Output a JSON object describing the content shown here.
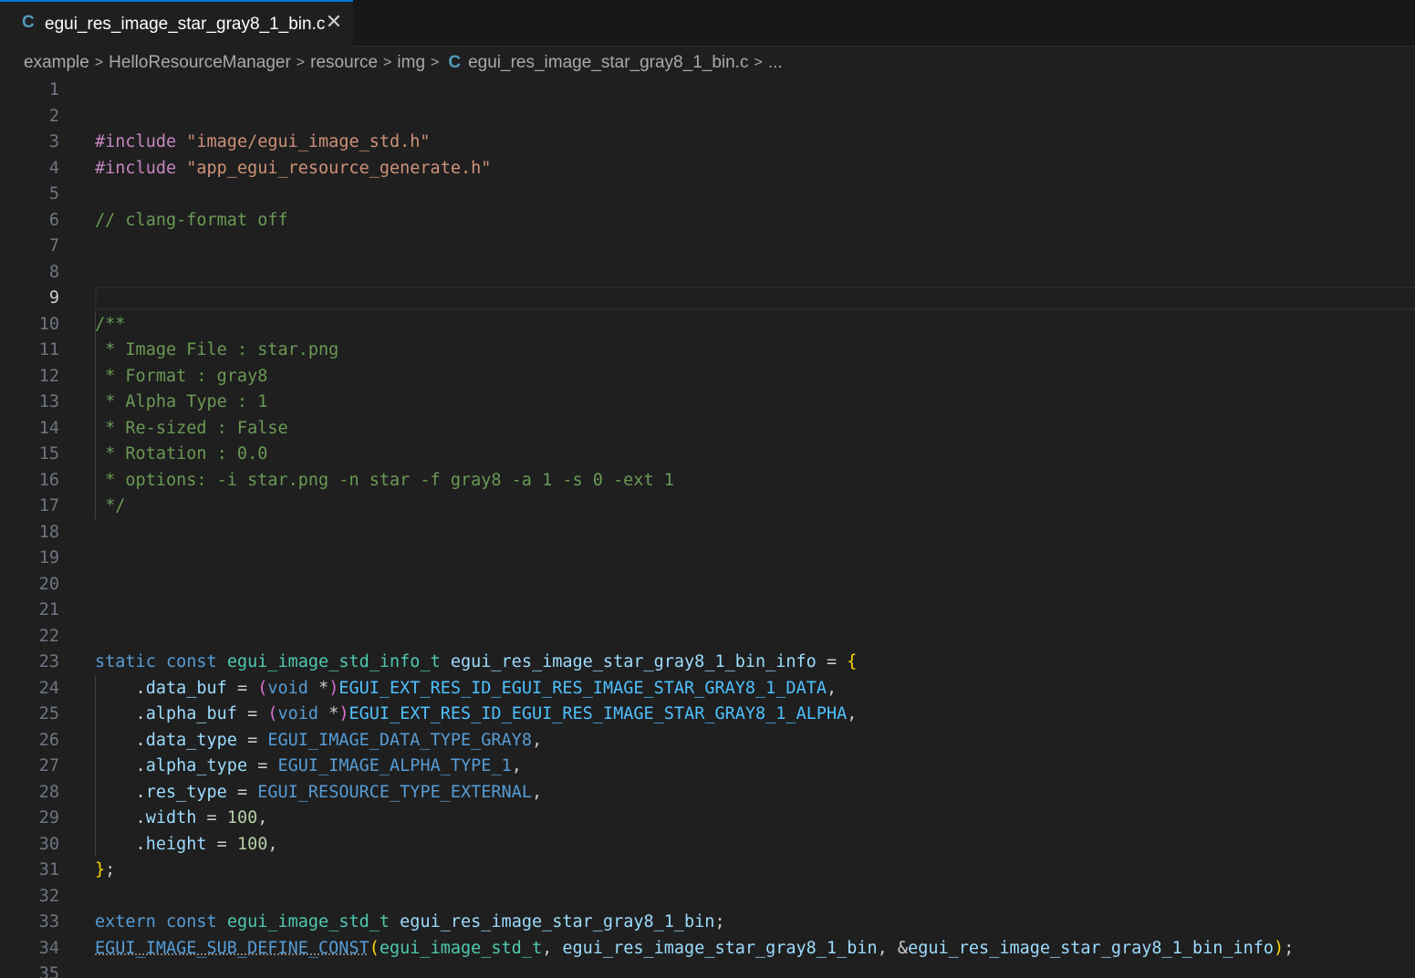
{
  "tab": {
    "icon": "C",
    "title": "egui_res_image_star_gray8_1_bin.c",
    "close": "✕"
  },
  "breadcrumb": {
    "items": [
      "example",
      "HelloResourceManager",
      "resource",
      "img"
    ],
    "file_icon": "C",
    "file": "egui_res_image_star_gray8_1_bin.c",
    "more": "...",
    "separator": ">"
  },
  "editor": {
    "active_line": 9,
    "lines": [
      {
        "n": "1",
        "t": []
      },
      {
        "n": "2",
        "t": []
      },
      {
        "n": "3",
        "t": [
          [
            "kw-inc",
            "#include"
          ],
          [
            "",
            " "
          ],
          [
            "str",
            "\"image/egui_image_std.h\""
          ]
        ]
      },
      {
        "n": "4",
        "t": [
          [
            "kw-inc",
            "#include"
          ],
          [
            "",
            " "
          ],
          [
            "str",
            "\"app_egui_resource_generate.h\""
          ]
        ]
      },
      {
        "n": "5",
        "t": []
      },
      {
        "n": "6",
        "t": [
          [
            "cmt",
            "// clang-format off"
          ]
        ]
      },
      {
        "n": "7",
        "t": []
      },
      {
        "n": "8",
        "t": []
      },
      {
        "n": "9",
        "t": []
      },
      {
        "n": "10",
        "t": [
          [
            "cmt",
            "/**"
          ]
        ]
      },
      {
        "n": "11",
        "t": [
          [
            "cmt",
            " * Image File : star.png"
          ]
        ]
      },
      {
        "n": "12",
        "t": [
          [
            "cmt",
            " * Format : gray8"
          ]
        ]
      },
      {
        "n": "13",
        "t": [
          [
            "cmt",
            " * Alpha Type : 1"
          ]
        ]
      },
      {
        "n": "14",
        "t": [
          [
            "cmt",
            " * Re-sized : False"
          ]
        ]
      },
      {
        "n": "15",
        "t": [
          [
            "cmt",
            " * Rotation : 0.0"
          ]
        ]
      },
      {
        "n": "16",
        "t": [
          [
            "cmt",
            " * options: -i star.png -n star -f gray8 -a 1 -s 0 -ext 1"
          ]
        ]
      },
      {
        "n": "17",
        "t": [
          [
            "cmt",
            " */"
          ]
        ]
      },
      {
        "n": "18",
        "t": []
      },
      {
        "n": "19",
        "t": []
      },
      {
        "n": "20",
        "t": []
      },
      {
        "n": "21",
        "t": []
      },
      {
        "n": "22",
        "t": []
      },
      {
        "n": "23",
        "t": [
          [
            "kw",
            "static"
          ],
          [
            "",
            " "
          ],
          [
            "kw",
            "const"
          ],
          [
            "",
            " "
          ],
          [
            "typ",
            "egui_image_std_info_t"
          ],
          [
            "",
            " "
          ],
          [
            "var",
            "egui_res_image_star_gray8_1_bin_info"
          ],
          [
            "",
            " = "
          ],
          [
            "brace1",
            "{"
          ]
        ]
      },
      {
        "n": "24",
        "t": [
          [
            "",
            "    ."
          ],
          [
            "var",
            "data_buf"
          ],
          [
            "",
            " = "
          ],
          [
            "brace2",
            "("
          ],
          [
            "kw",
            "void"
          ],
          [
            "",
            " *"
          ],
          [
            "brace2",
            ")"
          ],
          [
            "mac",
            "EGUI_EXT_RES_ID_EGUI_RES_IMAGE_STAR_GRAY8_1_DATA"
          ],
          [
            "",
            ","
          ]
        ]
      },
      {
        "n": "25",
        "t": [
          [
            "",
            "    ."
          ],
          [
            "var",
            "alpha_buf"
          ],
          [
            "",
            " = "
          ],
          [
            "brace2",
            "("
          ],
          [
            "kw",
            "void"
          ],
          [
            "",
            " *"
          ],
          [
            "brace2",
            ")"
          ],
          [
            "mac",
            "EGUI_EXT_RES_ID_EGUI_RES_IMAGE_STAR_GRAY8_1_ALPHA"
          ],
          [
            "",
            ","
          ]
        ]
      },
      {
        "n": "26",
        "t": [
          [
            "",
            "    ."
          ],
          [
            "var",
            "data_type"
          ],
          [
            "",
            " = "
          ],
          [
            "kw",
            "EGUI_IMAGE_DATA_TYPE_GRAY8"
          ],
          [
            "",
            ","
          ]
        ]
      },
      {
        "n": "27",
        "t": [
          [
            "",
            "    ."
          ],
          [
            "var",
            "alpha_type"
          ],
          [
            "",
            " = "
          ],
          [
            "kw",
            "EGUI_IMAGE_ALPHA_TYPE_1"
          ],
          [
            "",
            ","
          ]
        ]
      },
      {
        "n": "28",
        "t": [
          [
            "",
            "    ."
          ],
          [
            "var",
            "res_type"
          ],
          [
            "",
            " = "
          ],
          [
            "kw",
            "EGUI_RESOURCE_TYPE_EXTERNAL"
          ],
          [
            "",
            ","
          ]
        ]
      },
      {
        "n": "29",
        "t": [
          [
            "",
            "    ."
          ],
          [
            "var",
            "width"
          ],
          [
            "",
            " = "
          ],
          [
            "num",
            "100"
          ],
          [
            "",
            ","
          ]
        ]
      },
      {
        "n": "30",
        "t": [
          [
            "",
            "    ."
          ],
          [
            "var",
            "height"
          ],
          [
            "",
            " = "
          ],
          [
            "num",
            "100"
          ],
          [
            "",
            ","
          ]
        ]
      },
      {
        "n": "31",
        "t": [
          [
            "brace1",
            "}"
          ],
          [
            "",
            ";"
          ]
        ]
      },
      {
        "n": "32",
        "t": []
      },
      {
        "n": "33",
        "t": [
          [
            "kw",
            "extern"
          ],
          [
            "",
            " "
          ],
          [
            "kw",
            "const"
          ],
          [
            "",
            " "
          ],
          [
            "typ",
            "egui_image_std_t"
          ],
          [
            "",
            " "
          ],
          [
            "var",
            "egui_res_image_star_gray8_1_bin"
          ],
          [
            "",
            ";"
          ]
        ]
      },
      {
        "n": "34",
        "t": [
          [
            "kw squig",
            "EGUI_IMAGE_SUB_DEFINE_CONST"
          ],
          [
            "brace1",
            "("
          ],
          [
            "typ",
            "egui_image_std_t"
          ],
          [
            "",
            ", "
          ],
          [
            "var",
            "egui_res_image_star_gray8_1_bin"
          ],
          [
            "",
            ", &"
          ],
          [
            "var",
            "egui_res_image_star_gray8_1_bin_info"
          ],
          [
            "brace1",
            ")"
          ],
          [
            "",
            ";"
          ]
        ]
      },
      {
        "n": "35",
        "t": []
      }
    ]
  }
}
